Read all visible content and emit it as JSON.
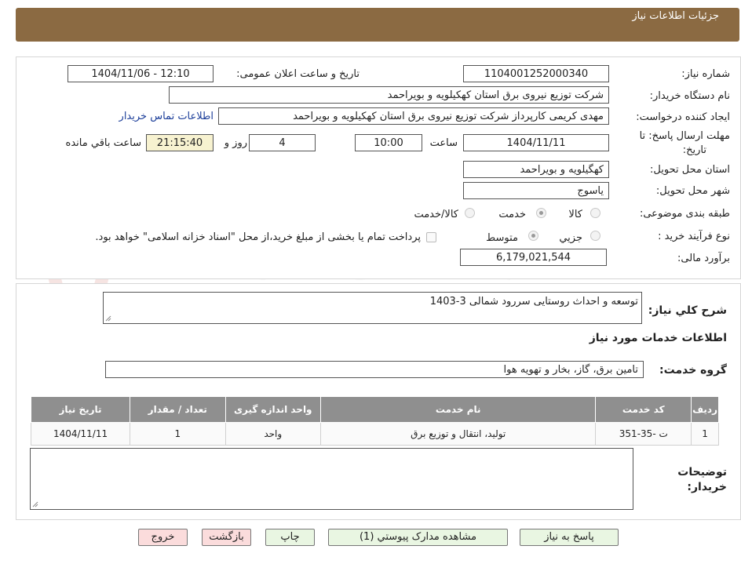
{
  "header": {
    "title": "جزئیات اطلاعات نیاز"
  },
  "fields": {
    "need_number": {
      "label": "شماره نیاز:",
      "value": "1104001252000340"
    },
    "announce_datetime": {
      "label": "تاریخ و ساعت اعلان عمومی:",
      "value": "1404/11/06 - 12:10"
    },
    "buyer_org": {
      "label": "نام دستگاه خریدار:",
      "value": "شرکت توزیع نیروی برق استان کهکیلویه و بویراحمد"
    },
    "requester": {
      "label": "ایجاد کننده درخواست:",
      "value": "مهدی کریمی کارپرداز شرکت توزیع نیروی برق استان کهکیلویه و بویراحمد",
      "contact_link": "اطلاعات تماس خریدار"
    },
    "deadline": {
      "label_line1": "مهلت ارسال پاسخ: تا",
      "label_line2": "تاریخ:",
      "date": "1404/11/11",
      "time_label": "ساعت",
      "time": "10:00",
      "days": "4",
      "days_label": "روز و",
      "remaining": "21:15:40",
      "remaining_label": "ساعت باقي مانده"
    },
    "province": {
      "label": "استان محل تحویل:",
      "value": "کهگیلویه و بویراحمد"
    },
    "city": {
      "label": "شهر محل تحویل:",
      "value": "یاسوج"
    },
    "category": {
      "label": "طبقه بندی موضوعی:",
      "options": [
        "کالا",
        "خدمت",
        "کالا/خدمت"
      ],
      "selected": "خدمت"
    },
    "process": {
      "label": "نوع فرآیند خرید :",
      "options": [
        "جزیي",
        "متوسط"
      ],
      "selected": "متوسط",
      "note": "پرداخت تمام یا بخشی از مبلغ خرید،از محل \"اسناد خزانه اسلامی\" خواهد بود."
    },
    "estimate": {
      "label": "برآورد مالی:",
      "value": "6,179,021,544"
    }
  },
  "description": {
    "label": "شرح کلي نیاز:",
    "value": "توسعه و احداث روستایی سررود شمالی 3-1403"
  },
  "services_section": {
    "title": "اطلاعات خدمات مورد نیاز"
  },
  "service_group": {
    "label": "گروه خدمت:",
    "value": "تامین برق، گاز، بخار و تهویه هوا"
  },
  "table": {
    "headers": [
      "ردیف",
      "کد خدمت",
      "نام خدمت",
      "واحد اندازه گیری",
      "تعداد / مقدار",
      "تاریخ نیاز"
    ],
    "rows": [
      [
        "1",
        "ت -35-351",
        "تولید، انتقال و توزیع برق",
        "واحد",
        "1",
        "1404/11/11"
      ]
    ]
  },
  "buyer_notes": {
    "label_line1": "توضیحات",
    "label_line2": "خریدار:",
    "value": ""
  },
  "buttons": {
    "reply": "پاسخ به نیاز",
    "attachments": "مشاهده مدارک پیوستي (1)",
    "print": "چاپ",
    "back": "بازگشت",
    "exit": "خروج"
  },
  "watermark": "AriaTender.net",
  "colors": {
    "header_bg": "#8b6a42",
    "table_header_bg": "#8f8f8f",
    "button_green": "#e9f6e2",
    "button_pink": "#fbdcdc",
    "remaining_bg": "#f7f2d0",
    "link": "#1d3f9a"
  }
}
